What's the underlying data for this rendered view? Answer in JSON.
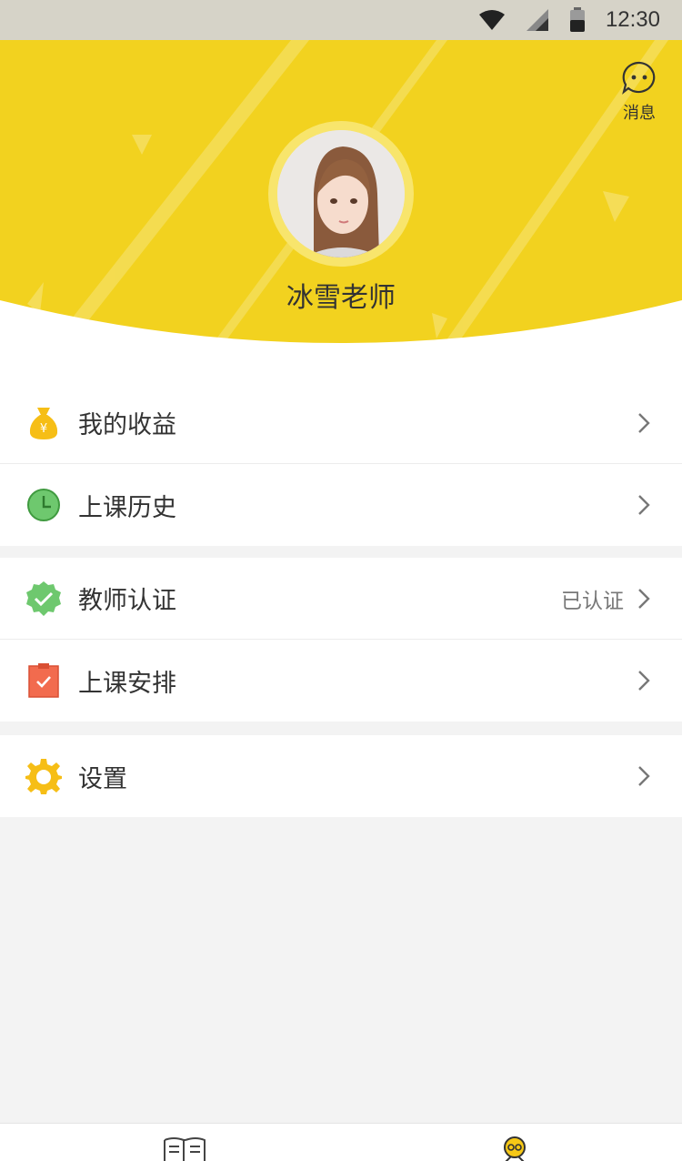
{
  "status_bar": {
    "time": "12:30"
  },
  "header": {
    "message_label": "消息",
    "username": "冰雪老师"
  },
  "menu": {
    "group1": [
      {
        "label": "我的收益",
        "icon": "money-bag-icon"
      },
      {
        "label": "上课历史",
        "icon": "clock-icon"
      }
    ],
    "group2": [
      {
        "label": "教师认证",
        "value": "已认证",
        "icon": "verified-badge-icon"
      },
      {
        "label": "上课安排",
        "icon": "clipboard-check-icon"
      }
    ],
    "group3": [
      {
        "label": "设置",
        "icon": "gear-icon"
      }
    ]
  },
  "tabs": [
    {
      "name": "course",
      "icon": "book-icon"
    },
    {
      "name": "profile",
      "icon": "profile-icon"
    }
  ],
  "colors": {
    "brand_yellow": "#f2d21f",
    "status_bar": "#d6d3c8",
    "page_bg": "#f3f3f3"
  }
}
